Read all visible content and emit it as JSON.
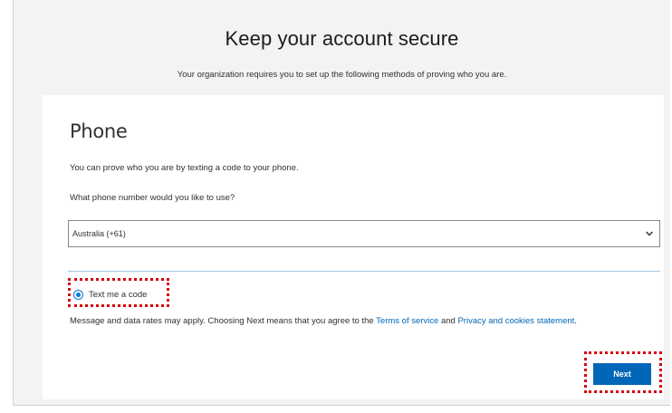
{
  "header": {
    "title": "Keep your account secure",
    "subtitle": "Your organization requires you to set up the following methods of proving who you are."
  },
  "card": {
    "title": "Phone",
    "description": "You can prove who you are by texting a code to your phone.",
    "question": "What phone number would you like to use?",
    "country_select": {
      "value": "Australia (+61)"
    },
    "radio": {
      "label": "Text me a code",
      "checked": true
    },
    "disclaimer": {
      "prefix": "Message and data rates may apply. Choosing Next means that you agree to the ",
      "terms_link": "Terms of service",
      "middle": " and ",
      "privacy_link": "Privacy and cookies statement",
      "suffix": "."
    },
    "next_label": "Next"
  },
  "colors": {
    "accent": "#0067b8",
    "highlight": "#d6000f",
    "background": "#f3f3f3"
  },
  "icons": {
    "select_chevron": "chevron-down-icon"
  }
}
